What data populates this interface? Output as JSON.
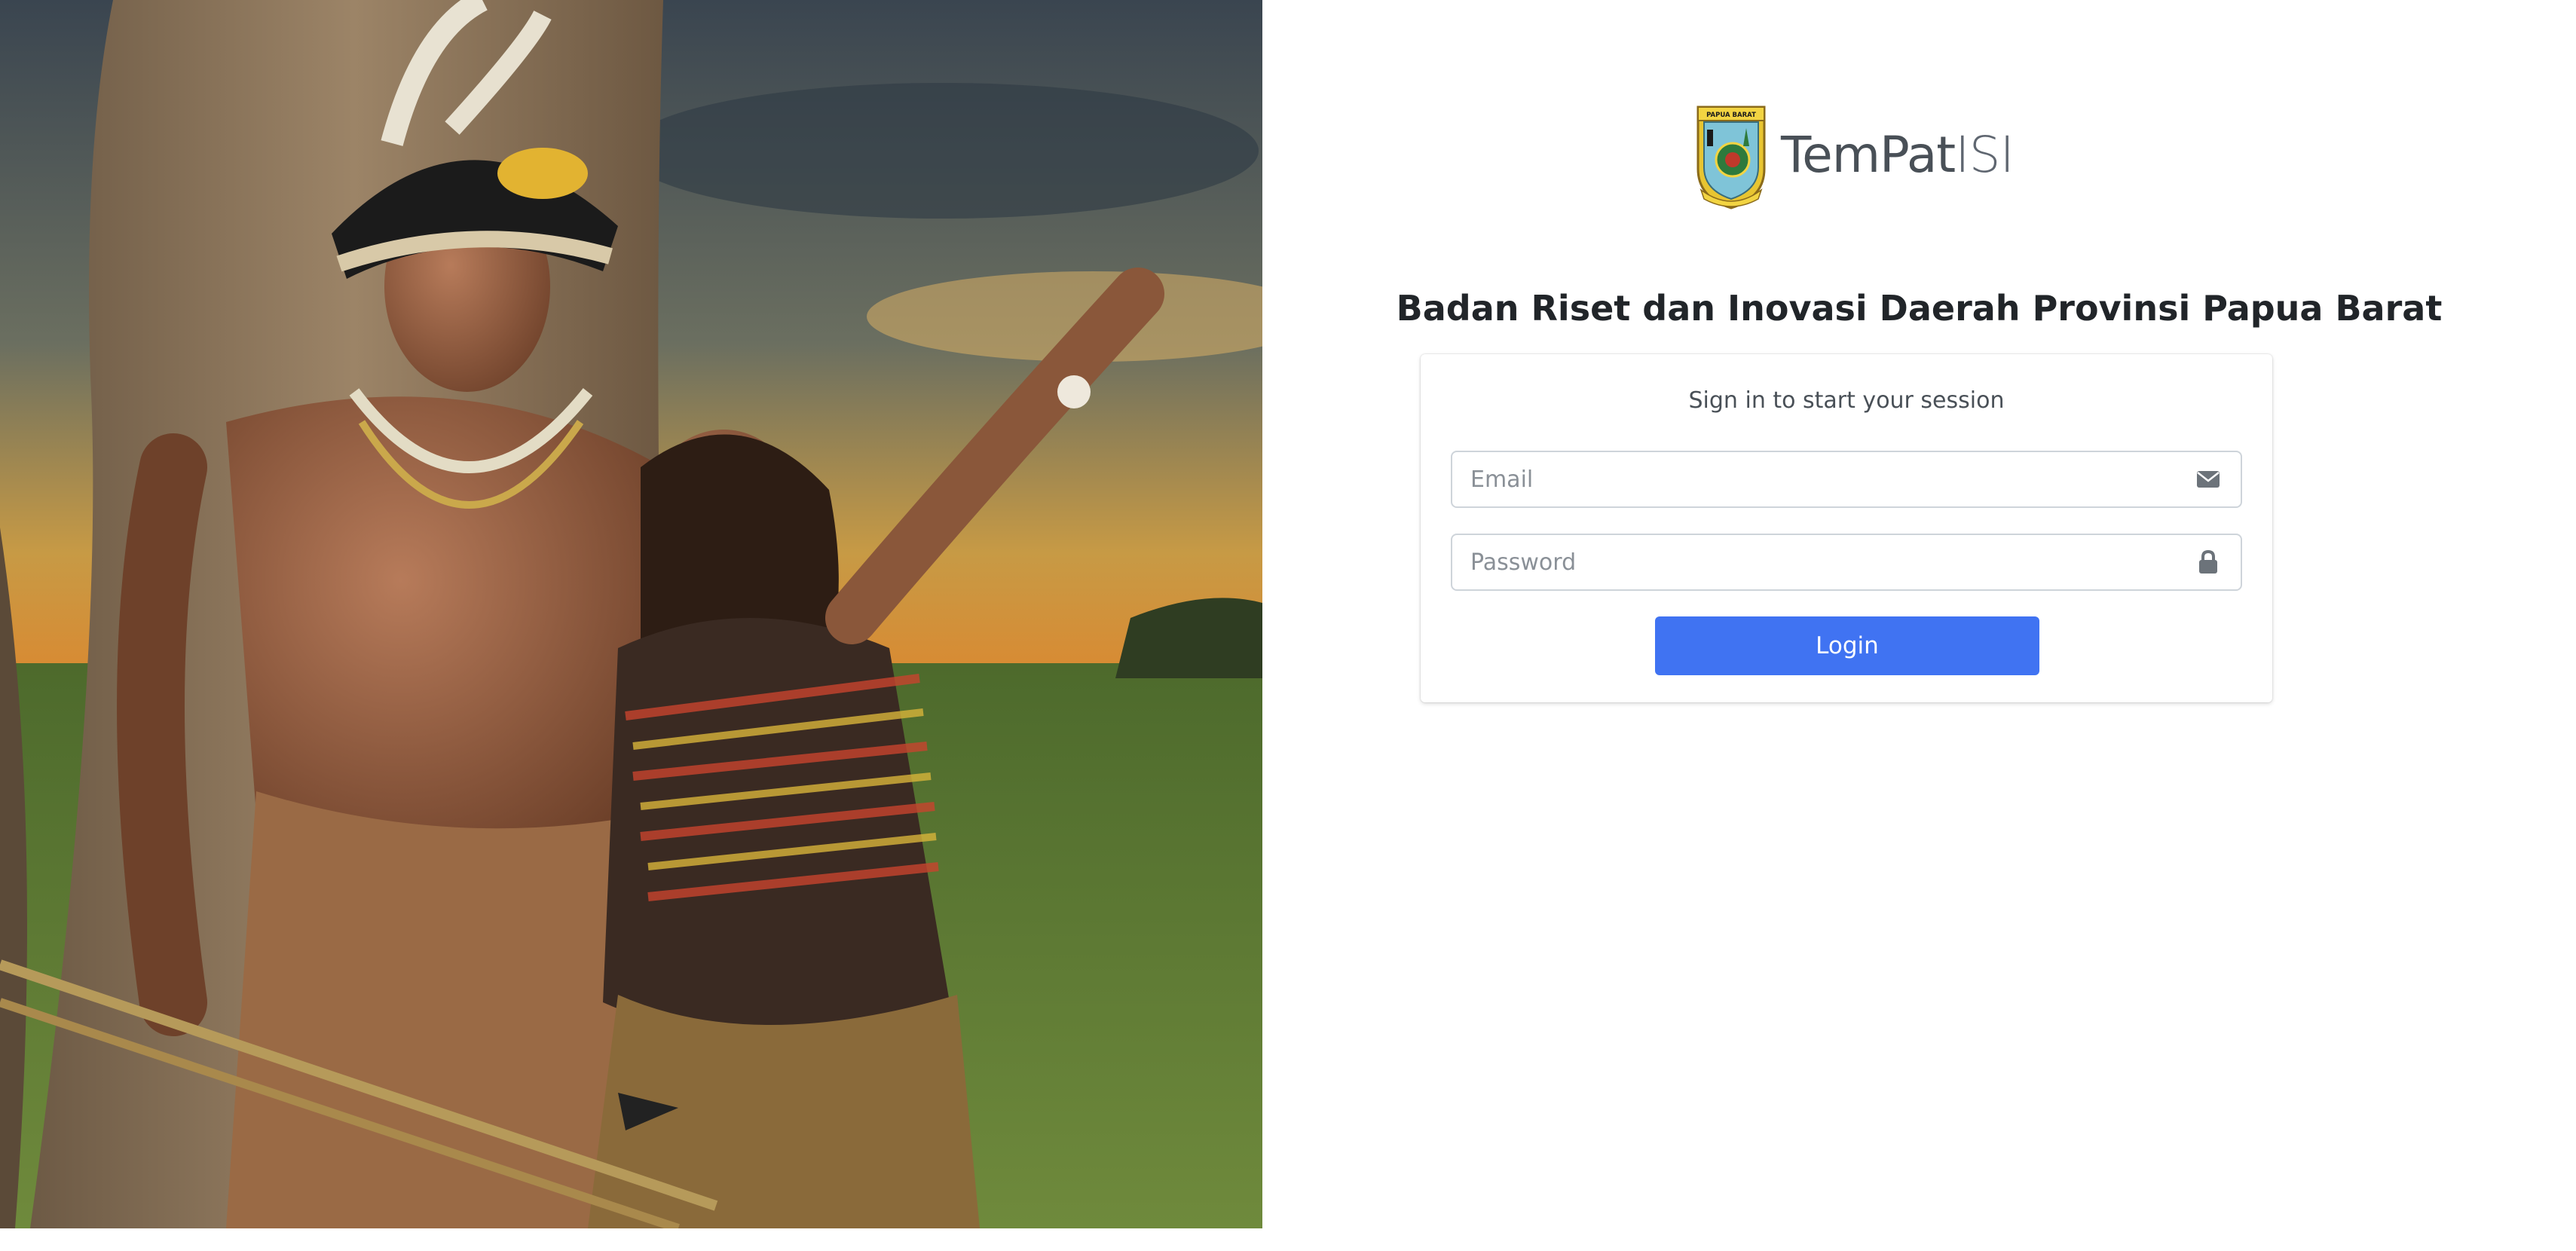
{
  "app": {
    "brand_name_bold": "TemPat",
    "brand_name_light": "ISI",
    "logo": {
      "icon": "papua-barat-emblem-icon",
      "emblem_text": "PAPUA BARAT"
    }
  },
  "header": {
    "agency_title": "Badan Riset dan Inovasi Daerah Provinsi Papua Barat"
  },
  "login_card": {
    "message": "Sign in to start your session",
    "email": {
      "placeholder": "Email",
      "value": "",
      "icon": "envelope-icon"
    },
    "password": {
      "placeholder": "Password",
      "value": "",
      "icon": "lock-icon"
    },
    "submit_label": "Login"
  },
  "colors": {
    "primary": "#4073f2",
    "text": "#212529",
    "muted": "#495057",
    "input_border": "#ced4da"
  }
}
